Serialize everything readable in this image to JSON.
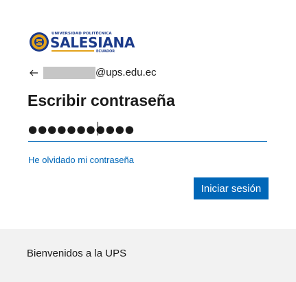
{
  "logo": {
    "line1": "UNIVERSIDAD POLITÉCNICA",
    "name": "SALESIANA",
    "country": "ECUADOR",
    "colors": {
      "blue": "#1b3a8a",
      "gold": "#e3a21a"
    }
  },
  "identity": {
    "back_icon": "back-arrow-icon",
    "email_domain": "@ups.edu.ec"
  },
  "title": "Escribir contraseña",
  "password": {
    "masked_value": "●●●●●●●●●●●",
    "accent": "#0067b8"
  },
  "forgot_link": "He olvidado mi contraseña",
  "signin_button": "Iniciar sesión",
  "footer": {
    "text": "Bienvenidos a la UPS"
  },
  "colors": {
    "primary": "#0067b8",
    "footer_bg": "#f2f2f2",
    "text": "#1b1b1b"
  }
}
